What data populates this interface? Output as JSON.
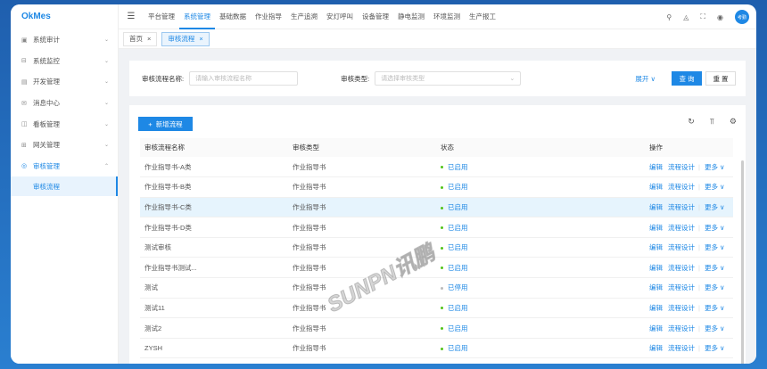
{
  "app": {
    "logo": "OkMes"
  },
  "sidebar": {
    "items": [
      {
        "label": "系统审计",
        "icon": "audit-icon"
      },
      {
        "label": "系统监控",
        "icon": "monitor-icon"
      },
      {
        "label": "开发管理",
        "icon": "dev-icon"
      },
      {
        "label": "消息中心",
        "icon": "message-icon"
      },
      {
        "label": "看板管理",
        "icon": "board-icon"
      },
      {
        "label": "网关管理",
        "icon": "gateway-icon"
      },
      {
        "label": "审核管理",
        "icon": "review-icon"
      }
    ],
    "sub_active": "审核流程"
  },
  "nav": {
    "items": [
      "平台管理",
      "系统管理",
      "基础数据",
      "作业指导",
      "生产追溯",
      "安灯呼叫",
      "设备管理",
      "静电监测",
      "环境监测",
      "生产报工"
    ],
    "active": 1
  },
  "user": {
    "avatar": "考勤"
  },
  "tabs": [
    {
      "label": "首页"
    },
    {
      "label": "审核流程"
    }
  ],
  "search": {
    "name_label": "审核流程名称:",
    "name_placeholder": "请输入审核流程名称",
    "type_label": "审核类型:",
    "type_placeholder": "请选择审核类型",
    "expand": "展开",
    "query": "查 询",
    "reset": "重 置"
  },
  "toolbar": {
    "add": "新增流程"
  },
  "table": {
    "headers": [
      "审核流程名称",
      "审核类型",
      "状态",
      "操作"
    ],
    "rows": [
      {
        "name": "作业指导书-A类",
        "type": "作业指导书",
        "status": "已启用",
        "on": true
      },
      {
        "name": "作业指导书-B类",
        "type": "作业指导书",
        "status": "已启用",
        "on": true
      },
      {
        "name": "作业指导书-C类",
        "type": "作业指导书",
        "status": "已启用",
        "on": true
      },
      {
        "name": "作业指导书-D类",
        "type": "作业指导书",
        "status": "已启用",
        "on": true
      },
      {
        "name": "测试审核",
        "type": "作业指导书",
        "status": "已启用",
        "on": true
      },
      {
        "name": "作业指导书测试...",
        "type": "作业指导书",
        "status": "已启用",
        "on": true
      },
      {
        "name": "测试",
        "type": "作业指导书",
        "status": "已停用",
        "on": false
      },
      {
        "name": "测试11",
        "type": "作业指导书",
        "status": "已启用",
        "on": true
      },
      {
        "name": "测试2",
        "type": "作业指导书",
        "status": "已启用",
        "on": true
      },
      {
        "name": "ZYSH",
        "type": "作业指导书",
        "status": "已启用",
        "on": true
      }
    ],
    "actions": {
      "edit": "编辑",
      "design": "流程设计",
      "more": "更多"
    }
  },
  "watermark": "SUNPN讯鹏",
  "colors": {
    "primary": "#1e88e5",
    "enabled": "#52c41a",
    "disabled": "#bbbbbb"
  }
}
